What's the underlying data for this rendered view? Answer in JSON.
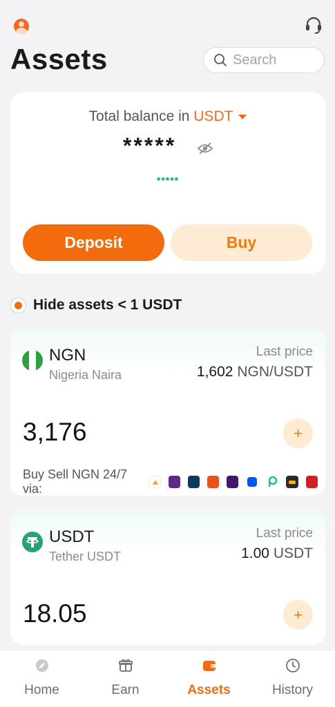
{
  "header": {
    "title": "Assets",
    "search_placeholder": "Search"
  },
  "balance": {
    "label": "Total balance in",
    "currency": "USDT",
    "value": "*****",
    "sub_value": "*****",
    "deposit_label": "Deposit",
    "buy_label": "Buy"
  },
  "filter": {
    "hide_label": "Hide assets < 1 USDT",
    "checked": true
  },
  "assets": [
    {
      "code": "NGN",
      "name": "Nigeria Naira",
      "price_label": "Last price",
      "price_number": "1,602",
      "price_unit": "NGN/USDT",
      "amount": "3,176",
      "via_label": "Buy Sell NGN 24/7 via:"
    },
    {
      "code": "USDT",
      "name": "Tether USDT",
      "price_label": "Last price",
      "price_number": "1.00",
      "price_unit": "USDT",
      "amount": "18.05"
    }
  ],
  "providers": [
    "partner-1",
    "fcmb-icon",
    "fidelity-icon",
    "gtbank-icon",
    "kuda-icon",
    "moniepoint-icon",
    "palmpay-icon",
    "partner-8",
    "uba-icon"
  ],
  "nav": [
    {
      "label": "Home",
      "icon": "home-icon"
    },
    {
      "label": "Earn",
      "icon": "earn-icon"
    },
    {
      "label": "Assets",
      "icon": "wallet-icon",
      "active": true
    },
    {
      "label": "History",
      "icon": "history-icon"
    }
  ],
  "colors": {
    "accent": "#f26b0d",
    "accent_soft": "#fdecd3",
    "positive": "#169a6b",
    "naira_green": "#2f9e44",
    "tether_green": "#26a17b"
  }
}
